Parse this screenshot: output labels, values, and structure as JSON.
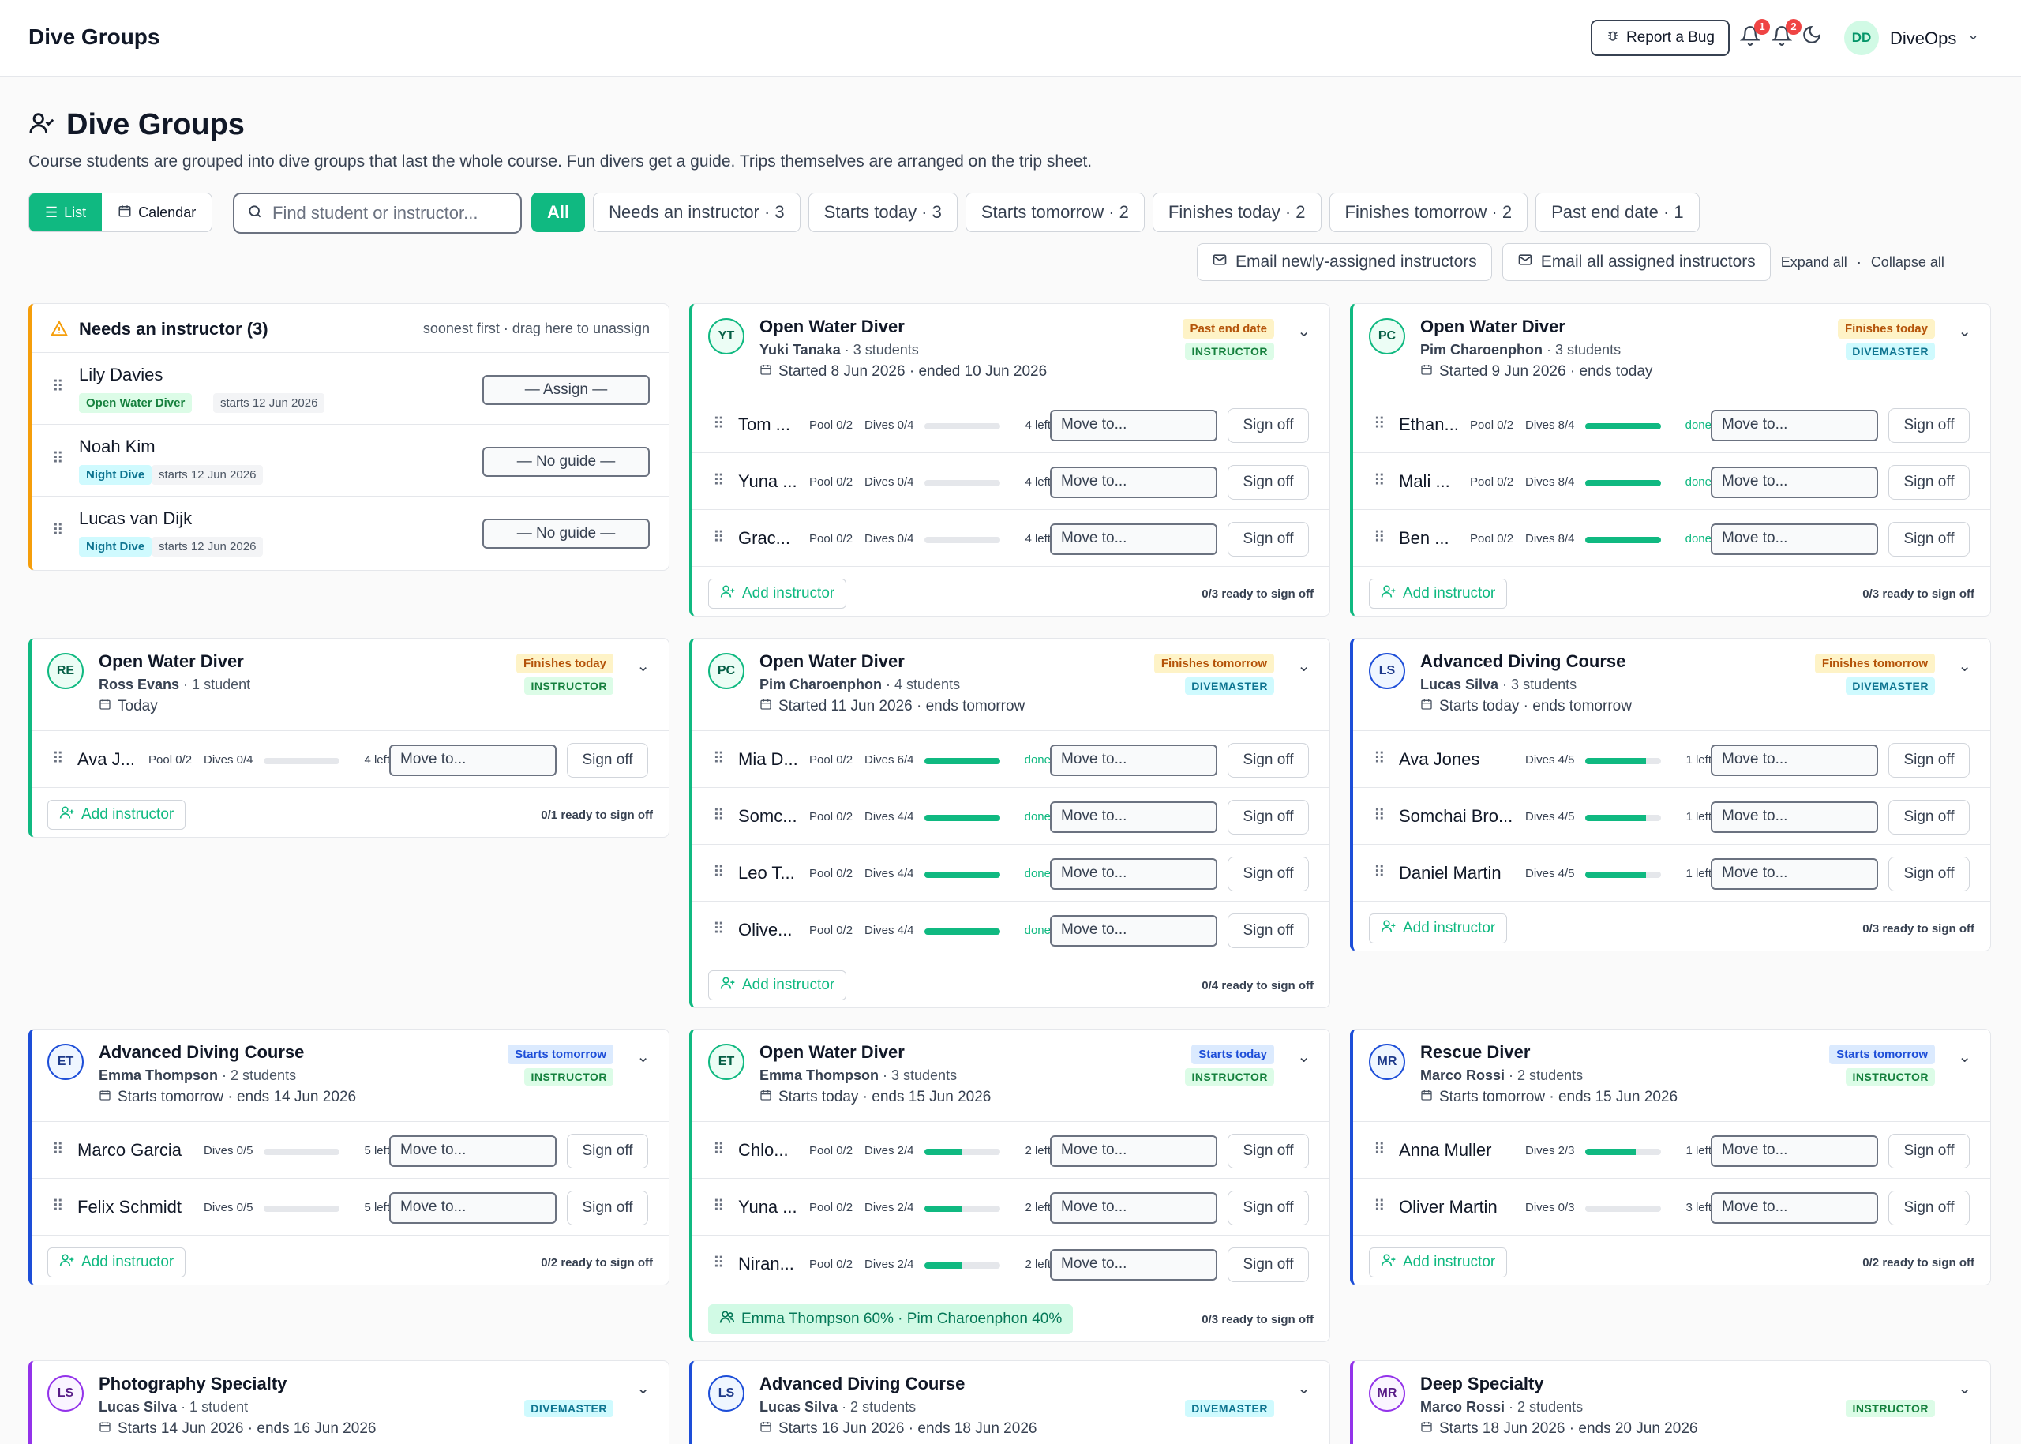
{
  "app": {
    "title": "Dive Groups",
    "report_bug": "Report a Bug",
    "bell1_count": "1",
    "bell2_count": "2",
    "user_initials": "DD",
    "user_name": "DiveOps"
  },
  "page": {
    "title": "Dive Groups",
    "subtitle": "Course students are grouped into dive groups that last the whole course. Fun divers get a guide. Trips themselves are arranged on the trip sheet."
  },
  "view": {
    "list": "List",
    "calendar": "Calendar",
    "active": "list"
  },
  "search": {
    "placeholder": "Find student or instructor...",
    "value": ""
  },
  "filters": [
    "All",
    "Needs an instructor · 3",
    "Starts today · 3",
    "Starts tomorrow · 2",
    "Finishes today · 2",
    "Finishes tomorrow · 2",
    "Past end date · 1"
  ],
  "actions": {
    "email_new": "Email newly-assigned instructors",
    "email_all": "Email all assigned instructors",
    "expand_all": "Expand all",
    "sep": "·",
    "collapse_all": "Collapse all"
  },
  "needs": {
    "title": "Needs an instructor (3)",
    "hint": "soonest first · drag here to unassign",
    "items": [
      {
        "name": "Lily Davies",
        "course": "Open Water Diver",
        "course_kind": "ow",
        "start": "starts 12 Jun 2026",
        "select": "— Assign —"
      },
      {
        "name": "Noah Kim",
        "course": "Night Dive",
        "course_kind": "nd",
        "start": "starts 12 Jun 2026",
        "select": "— No guide —"
      },
      {
        "name": "Lucas van Dijk",
        "course": "Night Dive",
        "course_kind": "nd",
        "start": "starts 12 Jun 2026",
        "select": "— No guide —"
      }
    ]
  },
  "groups": [
    {
      "id": "g1",
      "title": "Open Water Diver",
      "initials": "YT",
      "color": "green",
      "lead": "Yuki Tanaka",
      "count": " · 3 students",
      "dates": "Started 8 Jun 2026 · ended 10 Jun 2026",
      "tag": "Past end date",
      "tag_kind": "amber",
      "role": "INSTRUCTOR",
      "role_kind": "green",
      "students": [
        {
          "name": "Tom ...",
          "pool": "Pool 0/2",
          "dives": "Dives 0/4",
          "progress": 0,
          "left": "4 left"
        },
        {
          "name": "Yuna ...",
          "pool": "Pool 0/2",
          "dives": "Dives 0/4",
          "progress": 0,
          "left": "4 left"
        },
        {
          "name": "Grac...",
          "pool": "Pool 0/2",
          "dives": "Dives 0/4",
          "progress": 0,
          "left": "4 left"
        }
      ],
      "footer": "Add instructor",
      "footer_kind": "add",
      "ready": "0/3 ready to sign off"
    },
    {
      "id": "g2",
      "title": "Open Water Diver",
      "initials": "PC",
      "color": "green",
      "lead": "Pim Charoenphon",
      "count": " · 3 students",
      "dates": "Started 9 Jun 2026 · ends today",
      "tag": "Finishes today",
      "tag_kind": "amber",
      "role": "DIVEMASTER",
      "role_kind": "cyan",
      "students": [
        {
          "name": "Ethan...",
          "pool": "Pool 0/2",
          "dives": "Dives 8/4",
          "progress": 1,
          "left": "done"
        },
        {
          "name": "Mali ...",
          "pool": "Pool 0/2",
          "dives": "Dives 8/4",
          "progress": 1,
          "left": "done"
        },
        {
          "name": "Ben ...",
          "pool": "Pool 0/2",
          "dives": "Dives 8/4",
          "progress": 1,
          "left": "done"
        }
      ],
      "footer": "Add instructor",
      "footer_kind": "add",
      "ready": "0/3 ready to sign off"
    },
    {
      "id": "g3",
      "title": "Open Water Diver",
      "initials": "RE",
      "color": "green",
      "lead": "Ross Evans",
      "count": " · 1 student",
      "dates": "Today",
      "tag": "Finishes today",
      "tag_kind": "amber",
      "role": "INSTRUCTOR",
      "role_kind": "green",
      "students": [
        {
          "name": "Ava J...",
          "pool": "Pool 0/2",
          "dives": "Dives 0/4",
          "progress": 0,
          "left": "4 left"
        }
      ],
      "footer": "Add instructor",
      "footer_kind": "add",
      "ready": "0/1 ready to sign off"
    },
    {
      "id": "g4",
      "title": "Open Water Diver",
      "initials": "PC",
      "color": "green",
      "lead": "Pim Charoenphon",
      "count": " · 4 students",
      "dates": "Started 11 Jun 2026 · ends tomorrow",
      "tag": "Finishes tomorrow",
      "tag_kind": "amber",
      "role": "DIVEMASTER",
      "role_kind": "cyan",
      "students": [
        {
          "name": "Mia D...",
          "pool": "Pool 0/2",
          "dives": "Dives 6/4",
          "progress": 1,
          "left": "done"
        },
        {
          "name": "Somc...",
          "pool": "Pool 0/2",
          "dives": "Dives 4/4",
          "progress": 1,
          "left": "done"
        },
        {
          "name": "Leo T...",
          "pool": "Pool 0/2",
          "dives": "Dives 4/4",
          "progress": 1,
          "left": "done"
        },
        {
          "name": "Olive...",
          "pool": "Pool 0/2",
          "dives": "Dives 4/4",
          "progress": 1,
          "left": "done"
        }
      ],
      "footer": "Add instructor",
      "footer_kind": "add",
      "ready": "0/4 ready to sign off"
    },
    {
      "id": "g5",
      "title": "Advanced Diving Course",
      "initials": "LS",
      "color": "blue",
      "lead": "Lucas Silva",
      "count": " · 3 students",
      "dates": "Starts today · ends tomorrow",
      "tag": "Finishes tomorrow",
      "tag_kind": "amber",
      "role": "DIVEMASTER",
      "role_kind": "cyan",
      "students": [
        {
          "name": "Ava Jones",
          "pool": "",
          "dives": "Dives 4/5",
          "progress": 0.8,
          "left": "1 left"
        },
        {
          "name": "Somchai Bro...",
          "pool": "",
          "dives": "Dives 4/5",
          "progress": 0.8,
          "left": "1 left"
        },
        {
          "name": "Daniel Martin",
          "pool": "",
          "dives": "Dives 4/5",
          "progress": 0.8,
          "left": "1 left"
        }
      ],
      "footer": "Add instructor",
      "footer_kind": "add",
      "ready": "0/3 ready to sign off"
    },
    {
      "id": "g6",
      "title": "Advanced Diving Course",
      "initials": "ET",
      "color": "blue",
      "lead": "Emma Thompson",
      "count": " · 2 students",
      "dates": "Starts tomorrow · ends 14 Jun 2026",
      "tag": "Starts tomorrow",
      "tag_kind": "blue",
      "role": "INSTRUCTOR",
      "role_kind": "green",
      "students": [
        {
          "name": "Marco Garcia",
          "pool": "",
          "dives": "Dives 0/5",
          "progress": 0,
          "left": "5 left"
        },
        {
          "name": "Felix Schmidt",
          "pool": "",
          "dives": "Dives 0/5",
          "progress": 0,
          "left": "5 left"
        }
      ],
      "footer": "Add instructor",
      "footer_kind": "add",
      "ready": "0/2 ready to sign off"
    },
    {
      "id": "g7",
      "title": "Open Water Diver",
      "initials": "ET",
      "color": "green",
      "lead": "Emma Thompson",
      "count": " · 3 students",
      "dates": "Starts today · ends 15 Jun 2026",
      "tag": "Starts today",
      "tag_kind": "blue",
      "role": "INSTRUCTOR",
      "role_kind": "green",
      "students": [
        {
          "name": "Chlo...",
          "pool": "Pool 0/2",
          "dives": "Dives 2/4",
          "progress": 0.5,
          "left": "2 left"
        },
        {
          "name": "Yuna ...",
          "pool": "Pool 0/2",
          "dives": "Dives 2/4",
          "progress": 0.5,
          "left": "2 left"
        },
        {
          "name": "Niran...",
          "pool": "Pool 0/2",
          "dives": "Dives 2/4",
          "progress": 0.5,
          "left": "2 left"
        }
      ],
      "footer": "Emma Thompson 60% · Pim Charoenphon 40%",
      "footer_kind": "split",
      "ready": "0/3 ready to sign off"
    },
    {
      "id": "g8",
      "title": "Rescue Diver",
      "initials": "MR",
      "color": "blue",
      "lead": "Marco Rossi",
      "count": " · 2 students",
      "dates": "Starts tomorrow · ends 15 Jun 2026",
      "tag": "Starts tomorrow",
      "tag_kind": "blue",
      "role": "INSTRUCTOR",
      "role_kind": "green",
      "students": [
        {
          "name": "Anna Muller",
          "pool": "",
          "dives": "Dives 2/3",
          "progress": 0.67,
          "left": "1 left"
        },
        {
          "name": "Oliver Martin",
          "pool": "",
          "dives": "Dives 0/3",
          "progress": 0,
          "left": "3 left"
        }
      ],
      "footer": "Add instructor",
      "footer_kind": "add",
      "ready": "0/2 ready to sign off"
    },
    {
      "id": "g9",
      "title": "Photography Specialty",
      "initials": "LS",
      "color": "purple",
      "lead": "Lucas Silva",
      "count": " · 1 student",
      "dates": "Starts 14 Jun 2026 · ends 16 Jun 2026",
      "tag": "",
      "tag_kind": "",
      "role": "DIVEMASTER",
      "role_kind": "cyan",
      "students": [],
      "footer": "",
      "ready": ""
    },
    {
      "id": "g10",
      "title": "Advanced Diving Course",
      "initials": "LS",
      "color": "blue",
      "lead": "Lucas Silva",
      "count": " · 2 students",
      "dates": "Starts 16 Jun 2026 · ends 18 Jun 2026",
      "tag": "",
      "tag_kind": "",
      "role": "DIVEMASTER",
      "role_kind": "cyan",
      "students": [],
      "footer": "",
      "ready": ""
    },
    {
      "id": "g11",
      "title": "Deep Specialty",
      "initials": "MR",
      "color": "purple",
      "lead": "Marco Rossi",
      "count": " · 2 students",
      "dates": "Starts 18 Jun 2026 · ends 20 Jun 2026",
      "tag": "",
      "tag_kind": "",
      "role": "INSTRUCTOR",
      "role_kind": "green",
      "students": [],
      "footer": "",
      "ready": ""
    }
  ],
  "labels": {
    "move_to": "Move to...",
    "sign_off": "Sign off"
  }
}
